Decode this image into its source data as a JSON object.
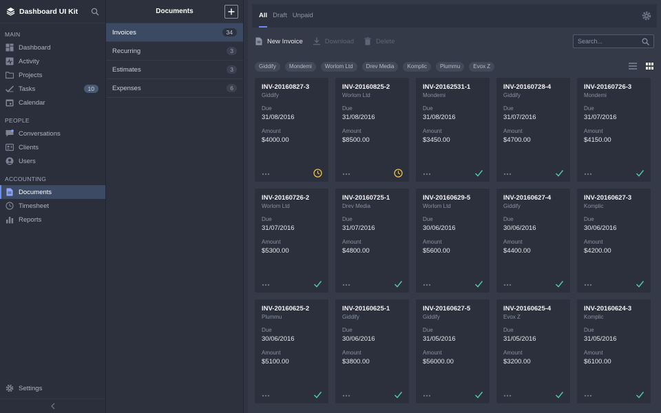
{
  "sidebar": {
    "brand": "Dashboard UI Kit",
    "sections": {
      "main": "MAIN",
      "people": "PEOPLE",
      "accounting": "ACCOUNTING"
    },
    "items": [
      {
        "label": "Dashboard",
        "icon": "dashboard-icon"
      },
      {
        "label": "Activity",
        "icon": "activity-icon"
      },
      {
        "label": "Projects",
        "icon": "folder-icon"
      },
      {
        "label": "Tasks",
        "icon": "check-icon",
        "badge": "10"
      },
      {
        "label": "Calendar",
        "icon": "calendar-icon"
      },
      {
        "label": "Conversations",
        "icon": "chat-icon"
      },
      {
        "label": "Clients",
        "icon": "clients-icon"
      },
      {
        "label": "Users",
        "icon": "users-icon"
      },
      {
        "label": "Documents",
        "icon": "document-icon"
      },
      {
        "label": "Timesheet",
        "icon": "clock-icon"
      },
      {
        "label": "Reports",
        "icon": "reports-icon"
      }
    ],
    "settings": "Settings"
  },
  "documents": {
    "title": "Documents",
    "items": [
      {
        "label": "Invoices",
        "count": "34"
      },
      {
        "label": "Recurring",
        "count": "3"
      },
      {
        "label": "Estimates",
        "count": "3"
      },
      {
        "label": "Expenses",
        "count": "6"
      }
    ]
  },
  "main": {
    "tabs": [
      "All",
      "Draft",
      "Unpaid"
    ],
    "toolbar": {
      "new_invoice": "New Invoice",
      "download": "Download",
      "delete": "Delete",
      "search_placeholder": "Search..."
    },
    "filters": [
      "Giddify",
      "Mondemi",
      "Worlom Ltd",
      "Drev Media",
      "Komplic",
      "Plummu",
      "Evox Z"
    ],
    "labels": {
      "due": "Due",
      "amount": "Amount"
    },
    "colors": {
      "accent": "#6c8cf5",
      "pending": "#e8c24a",
      "paid": "#52c7a6"
    },
    "invoices": [
      {
        "id": "INV-20160827-3",
        "client": "Giddify",
        "due": "31/08/2016",
        "amount": "$4000.00",
        "status": "pending"
      },
      {
        "id": "INV-20160825-2",
        "client": "Worlom Ltd",
        "due": "31/08/2016",
        "amount": "$8500.00",
        "status": "pending"
      },
      {
        "id": "INV-20162531-1",
        "client": "Mondemi",
        "due": "31/08/2016",
        "amount": "$3450.00",
        "status": "paid"
      },
      {
        "id": "INV-20160728-4",
        "client": "Giddify",
        "due": "31/07/2016",
        "amount": "$4700.00",
        "status": "paid"
      },
      {
        "id": "INV-20160726-3",
        "client": "Mondemi",
        "due": "31/07/2016",
        "amount": "$4150.00",
        "status": "paid"
      },
      {
        "id": "INV-20160726-2",
        "client": "Worlom Ltd",
        "due": "31/07/2016",
        "amount": "$5300.00",
        "status": "paid"
      },
      {
        "id": "INV-20160725-1",
        "client": "Drev Media",
        "due": "31/07/2016",
        "amount": "$4800.00",
        "status": "paid"
      },
      {
        "id": "INV-20160629-5",
        "client": "Worlom Ltd",
        "due": "30/06/2016",
        "amount": "$5600.00",
        "status": "paid"
      },
      {
        "id": "INV-20160627-4",
        "client": "Giddify",
        "due": "30/06/2016",
        "amount": "$4400.00",
        "status": "paid"
      },
      {
        "id": "INV-20160627-3",
        "client": "Komplic",
        "due": "30/06/2016",
        "amount": "$4200.00",
        "status": "paid"
      },
      {
        "id": "INV-20160625-2",
        "client": "Plummu",
        "due": "30/06/2016",
        "amount": "$5100.00",
        "status": "paid"
      },
      {
        "id": "INV-20160625-1",
        "client": "Giddify",
        "due": "30/06/2016",
        "amount": "$3800.00",
        "status": "paid"
      },
      {
        "id": "INV-20160627-5",
        "client": "Giddify",
        "due": "31/05/2016",
        "amount": "$56000.00",
        "status": "paid"
      },
      {
        "id": "INV-20160625-4",
        "client": "Evox Z",
        "due": "31/05/2016",
        "amount": "$3200.00",
        "status": "paid"
      },
      {
        "id": "INV-20160624-3",
        "client": "Komplic",
        "due": "31/05/2016",
        "amount": "$6100.00",
        "status": "paid"
      }
    ]
  }
}
